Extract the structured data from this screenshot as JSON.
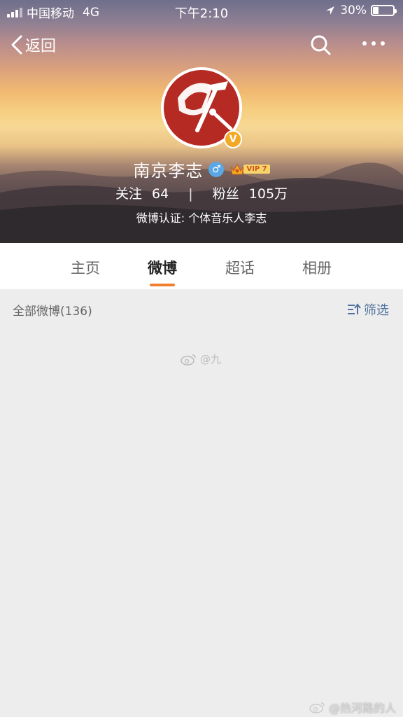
{
  "status_bar": {
    "carrier": "中国移动",
    "network": "4G",
    "time": "下午2:10",
    "battery_percent": "30%",
    "battery_level": 0.3
  },
  "nav": {
    "back_label": "返回"
  },
  "profile": {
    "name": "南京李志",
    "vip_label": "VIP 7",
    "following_label": "关注",
    "following_count": "64",
    "followers_label": "粉丝",
    "followers_count": "105万",
    "verification": "微博认证: 个体音乐人李志"
  },
  "tabs": [
    {
      "label": "主页",
      "active": false
    },
    {
      "label": "微博",
      "active": true
    },
    {
      "label": "超话",
      "active": false
    },
    {
      "label": "相册",
      "active": false
    }
  ],
  "feed": {
    "count_label": "全部微博(136)",
    "filter_label": "筛选"
  },
  "watermarks": {
    "center": "@九",
    "bottom": "@热河路的人"
  },
  "colors": {
    "accent": "#f08030",
    "link": "#50739f",
    "gender": "#5aa7e6",
    "verified": "#f3a826"
  }
}
